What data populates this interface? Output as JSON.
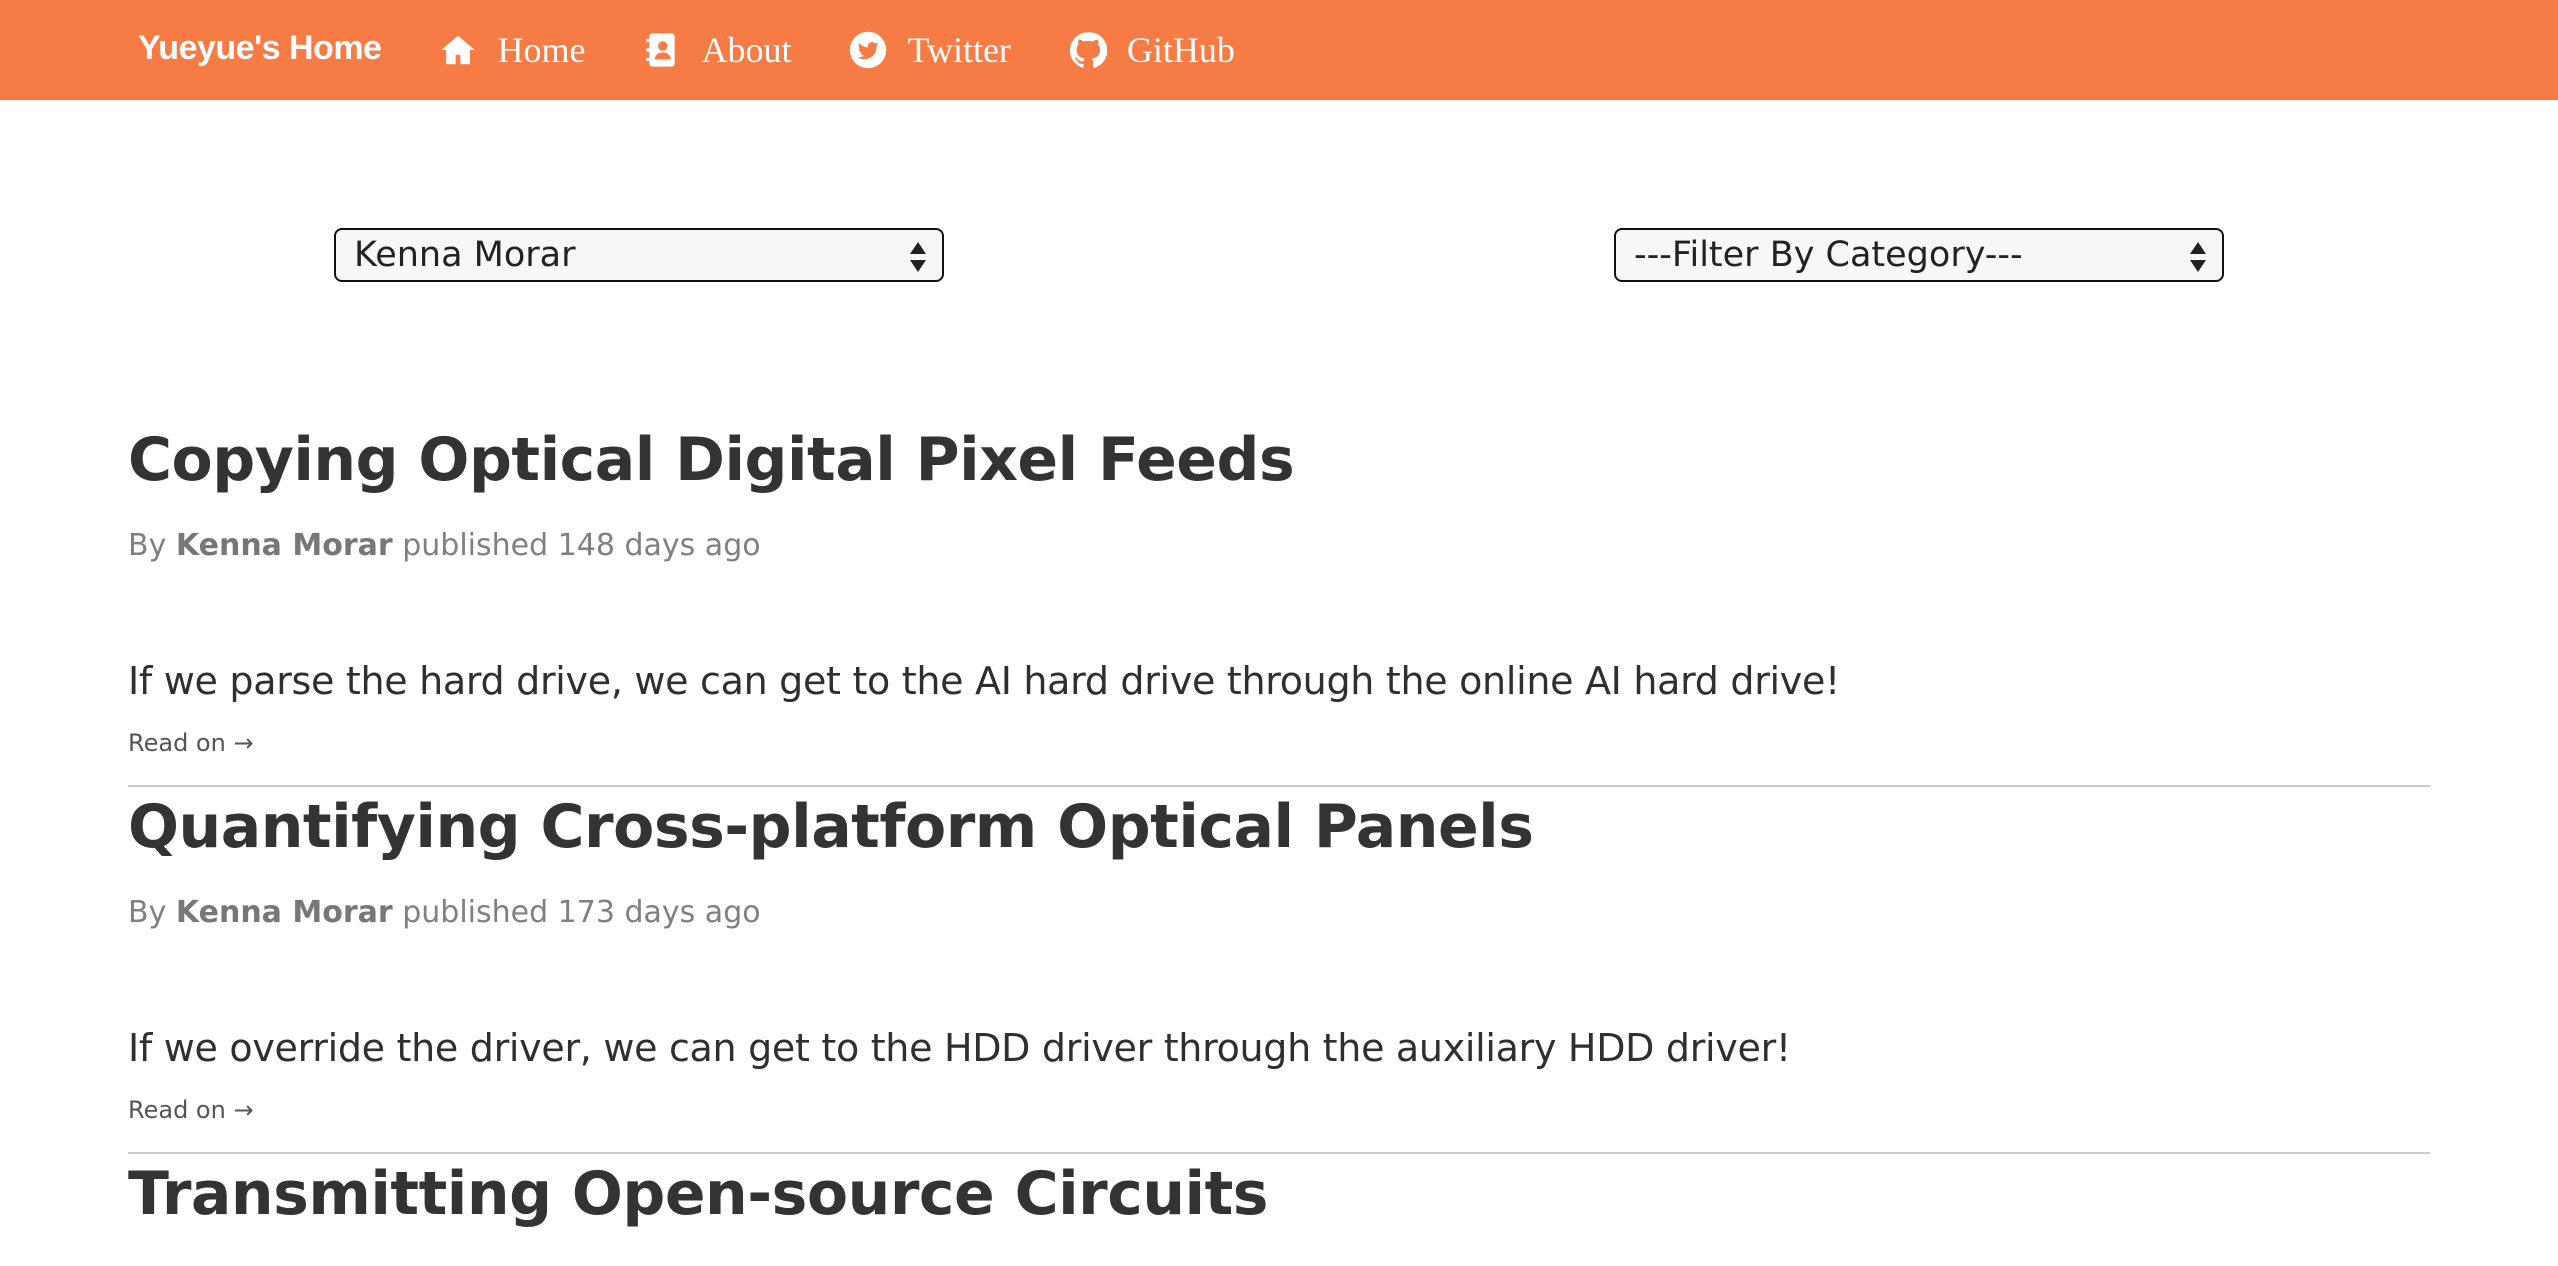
{
  "navbar": {
    "brand": "Yueyue's Home",
    "background": "#f77b45",
    "items": [
      {
        "label": "Home",
        "icon": "home-icon"
      },
      {
        "label": "About",
        "icon": "address-book-icon"
      },
      {
        "label": "Twitter",
        "icon": "twitter-icon"
      },
      {
        "label": "GitHub",
        "icon": "github-icon"
      }
    ]
  },
  "filters": {
    "author_selected": "Kenna Morar",
    "category_selected": "---Filter By Category---"
  },
  "posts": [
    {
      "title": "Copying Optical Digital Pixel Feeds",
      "by": "By",
      "author": "Kenna Morar",
      "published": "published 148 days ago",
      "summary": "If we parse the hard drive, we can get to the AI hard drive through the online AI hard drive!",
      "read_on": "Read on →"
    },
    {
      "title": "Quantifying Cross-platform Optical Panels",
      "by": "By",
      "author": "Kenna Morar",
      "published": "published 173 days ago",
      "summary": "If we override the driver, we can get to the HDD driver through the auxiliary HDD driver!",
      "read_on": "Read on →"
    },
    {
      "title": "Transmitting Open-source Circuits"
    }
  ]
}
